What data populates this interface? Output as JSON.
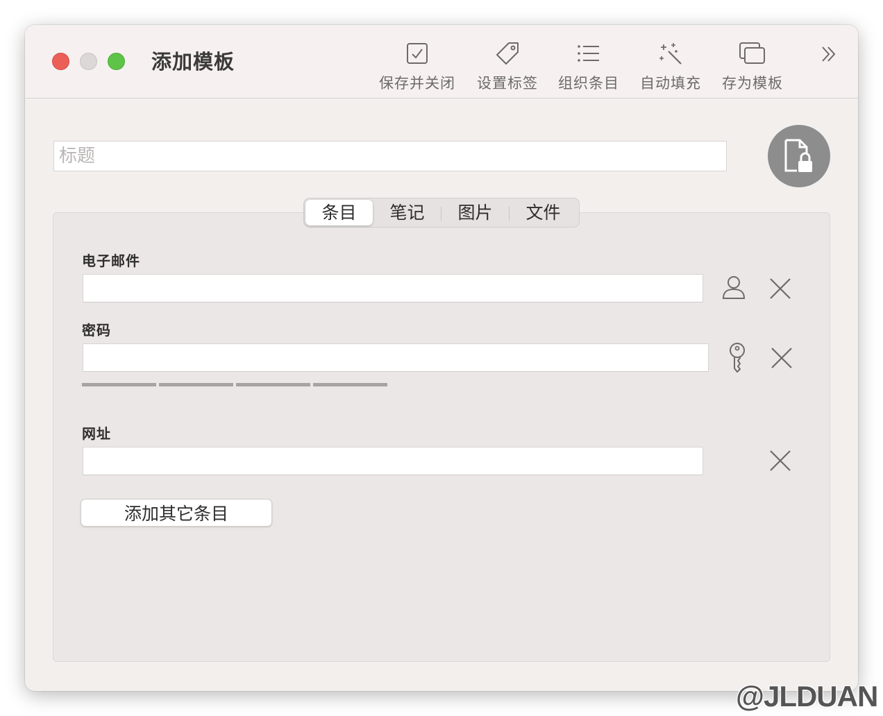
{
  "window": {
    "title": "添加模板"
  },
  "toolbar": {
    "items": [
      {
        "label": "保存并关闭",
        "icon": "checkbox-icon"
      },
      {
        "label": "设置标签",
        "icon": "tag-icon"
      },
      {
        "label": "组织条目",
        "icon": "list-icon"
      },
      {
        "label": "自动填充",
        "icon": "magic-wand-icon"
      },
      {
        "label": "存为模板",
        "icon": "template-icon"
      }
    ],
    "overflow_icon": "double-chevron-right-icon"
  },
  "title_field": {
    "placeholder": "标题",
    "value": ""
  },
  "lock_button": {
    "icon": "document-lock-icon"
  },
  "tabs": [
    {
      "label": "条目",
      "active": true
    },
    {
      "label": "笔记",
      "active": false
    },
    {
      "label": "图片",
      "active": false
    },
    {
      "label": "文件",
      "active": false
    }
  ],
  "fields": {
    "email": {
      "label": "电子邮件",
      "value": "",
      "action_icon": "person-icon",
      "remove_icon": "close-icon"
    },
    "password": {
      "label": "密码",
      "value": "",
      "action_icon": "key-icon",
      "remove_icon": "close-icon",
      "strength_segments": 4
    },
    "url": {
      "label": "网址",
      "value": "",
      "remove_icon": "close-icon"
    }
  },
  "add_button": {
    "label": "添加其它条目"
  },
  "watermark": "@JLDUAN",
  "colors": {
    "window_bg": "#f3efed",
    "panel_bg": "#ebe7e6",
    "close": "#ec5f57",
    "zoom": "#5ec447",
    "lock_btn": "#8e8d8d"
  }
}
